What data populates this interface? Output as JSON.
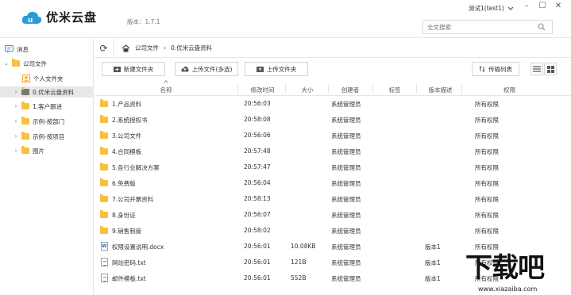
{
  "header": {
    "logo_text": "优米云盘",
    "version": "版本：1.7.1",
    "user": "测试1(test1)",
    "search_placeholder": "全文搜索"
  },
  "sidebar": {
    "items": [
      {
        "label": "消息"
      },
      {
        "label": "公司文件"
      },
      {
        "label": "个人文件夹"
      },
      {
        "label": "0.优米云盘资料"
      },
      {
        "label": "1.客户跟进"
      },
      {
        "label": "示例-按部门"
      },
      {
        "label": "示例-按项目"
      },
      {
        "label": "图片"
      }
    ]
  },
  "path": {
    "crumbs": [
      "公司文件",
      "0.优米云盘资料"
    ]
  },
  "toolbar": {
    "new_folder": "新建文件夹",
    "upload_files": "上传文件(多选)",
    "upload_folder": "上传文件夹",
    "transfer_list": "传输列表"
  },
  "table": {
    "headers": {
      "name": "名称",
      "modified": "修改时间",
      "size": "大小",
      "creator": "创建者",
      "tag": "标签",
      "version_desc": "版本描述",
      "permission": "权限"
    },
    "rows": [
      {
        "type": "folder",
        "name": "1.产品资料",
        "time": "20:56:03",
        "size": "",
        "creator": "系统管理员",
        "version": "",
        "perm": "所有权限"
      },
      {
        "type": "folder",
        "name": "2.系统授权书",
        "time": "20:58:08",
        "size": "",
        "creator": "系统管理员",
        "version": "",
        "perm": "所有权限"
      },
      {
        "type": "folder",
        "name": "3.公司文件",
        "time": "20:56:06",
        "size": "",
        "creator": "系统管理员",
        "version": "",
        "perm": "所有权限"
      },
      {
        "type": "folder",
        "name": "4.合同模板",
        "time": "20:57:48",
        "size": "",
        "creator": "系统管理员",
        "version": "",
        "perm": "所有权限"
      },
      {
        "type": "folder",
        "name": "5.各行业解决方案",
        "time": "20:57:47",
        "size": "",
        "creator": "系统管理员",
        "version": "",
        "perm": "所有权限"
      },
      {
        "type": "folder",
        "name": "6.免费版",
        "time": "20:56:04",
        "size": "",
        "creator": "系统管理员",
        "version": "",
        "perm": "所有权限"
      },
      {
        "type": "folder",
        "name": "7.公司开票资料",
        "time": "20:58:13",
        "size": "",
        "creator": "系统管理员",
        "version": "",
        "perm": "所有权限"
      },
      {
        "type": "folder",
        "name": "8.身份证",
        "time": "20:56:07",
        "size": "",
        "creator": "系统管理员",
        "version": "",
        "perm": "所有权限"
      },
      {
        "type": "folder",
        "name": "9.销售制度",
        "time": "20:58:02",
        "size": "",
        "creator": "系统管理员",
        "version": "",
        "perm": "所有权限"
      },
      {
        "type": "word",
        "name": "权限设置说明.docx",
        "time": "20:56:01",
        "size": "10.08KB",
        "creator": "系统管理员",
        "version": "版本1",
        "perm": "所有权限"
      },
      {
        "type": "txt",
        "name": "网站密码.txt",
        "time": "20:56:01",
        "size": "121B",
        "creator": "系统管理员",
        "version": "版本1",
        "perm": "所有权限"
      },
      {
        "type": "txt",
        "name": "邮件模板.txt",
        "time": "20:56:01",
        "size": "552B",
        "creator": "系统管理员",
        "version": "版本1",
        "perm": "所有权限"
      }
    ]
  },
  "watermark": {
    "big": "下载吧",
    "small": "www.xiazaiba.com"
  },
  "colors": {
    "folder": "#f6c23e",
    "logo_blue": "#2a9bd8"
  }
}
